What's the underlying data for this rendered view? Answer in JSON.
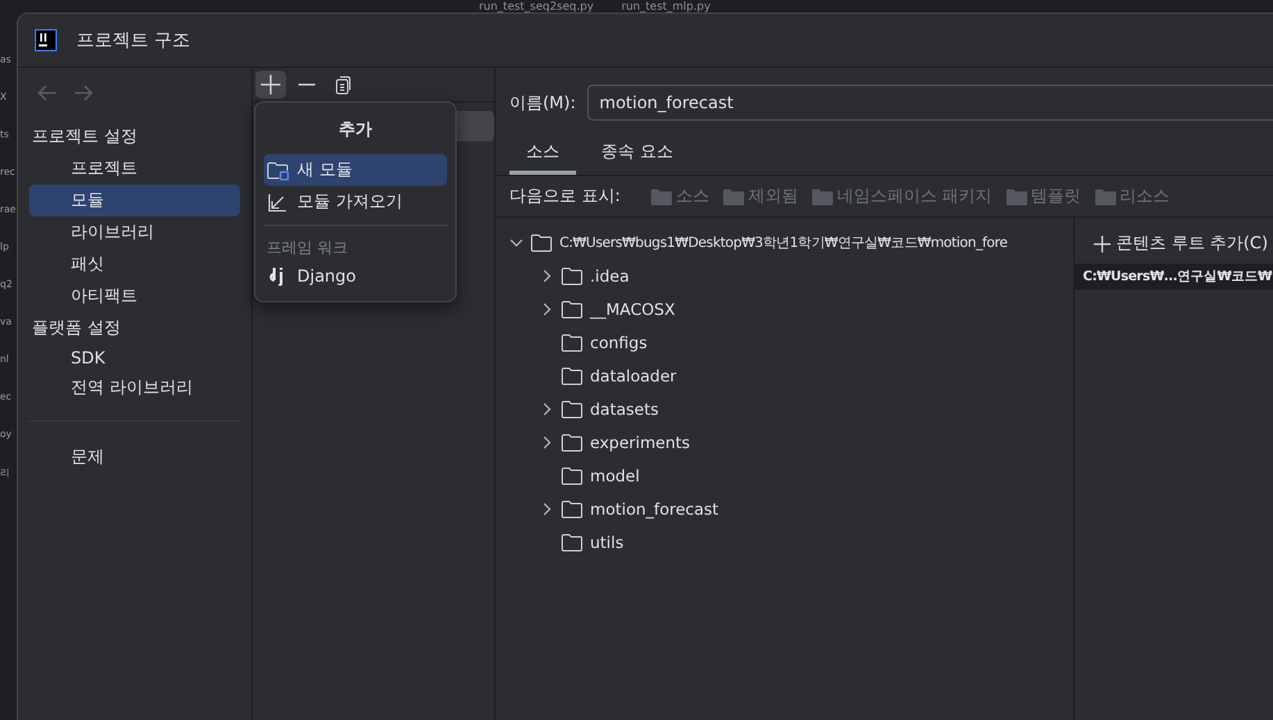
{
  "background": {
    "editor_tabs": [
      "run_test_seq2seq.py",
      "run_test_mlp.py"
    ],
    "side_fragments": [
      "as",
      "X",
      "ts",
      "rec",
      "rae",
      "lp",
      "q2",
      "va",
      "nl",
      "ec",
      "oy",
      "리"
    ]
  },
  "window": {
    "title": "프로젝트 구조"
  },
  "sidebar": {
    "sections": [
      {
        "title": "프로젝트 설정",
        "items": [
          {
            "label": "프로젝트",
            "selected": false
          },
          {
            "label": "모듈",
            "selected": true
          },
          {
            "label": "라이브러리",
            "selected": false
          },
          {
            "label": "패싯",
            "selected": false
          },
          {
            "label": "아티팩트",
            "selected": false
          }
        ]
      },
      {
        "title": "플랫폼 설정",
        "items": [
          {
            "label": "SDK",
            "selected": false
          },
          {
            "label": "전역 라이브러리",
            "selected": false
          }
        ]
      }
    ],
    "footer_items": [
      {
        "label": "문제",
        "selected": false
      }
    ]
  },
  "add_menu": {
    "title": "추가",
    "items": [
      {
        "kind": "item",
        "label": "새 모듈",
        "selected": true
      },
      {
        "kind": "item",
        "label": "모듈 가져오기",
        "selected": false
      },
      {
        "kind": "separator"
      },
      {
        "kind": "header",
        "label": "프레임 워크"
      },
      {
        "kind": "item",
        "label": "Django",
        "selected": false
      }
    ]
  },
  "name_field": {
    "label": "이름(M):",
    "value": "motion_forecast"
  },
  "tabs": [
    {
      "label": "소스",
      "selected": true
    },
    {
      "label": "종속 요소",
      "selected": false
    }
  ],
  "mark_as": {
    "label": "다음으로 표시:",
    "options": [
      "소스",
      "제외됨",
      "네임스페이스 패키지",
      "템플릿",
      "리소스"
    ]
  },
  "tree": {
    "label": "C:₩Users₩bugs1₩Desktop₩3학년1학기₩연구실₩코드₩motion_fore",
    "expanded": true,
    "children": [
      {
        "label": ".idea",
        "kind": "expandable"
      },
      {
        "label": "__MACOSX",
        "kind": "expandable"
      },
      {
        "label": "configs",
        "kind": "leaf"
      },
      {
        "label": "dataloader",
        "kind": "leaf"
      },
      {
        "label": "datasets",
        "kind": "expandable"
      },
      {
        "label": "experiments",
        "kind": "expandable"
      },
      {
        "label": "model",
        "kind": "leaf"
      },
      {
        "label": "motion_forecast",
        "kind": "expandable"
      },
      {
        "label": "utils",
        "kind": "leaf"
      }
    ]
  },
  "content_roots": {
    "add_label": "콘텐츠 루트 추가(C)",
    "roots": [
      "C:₩Users₩...연구실₩코드₩"
    ]
  }
}
